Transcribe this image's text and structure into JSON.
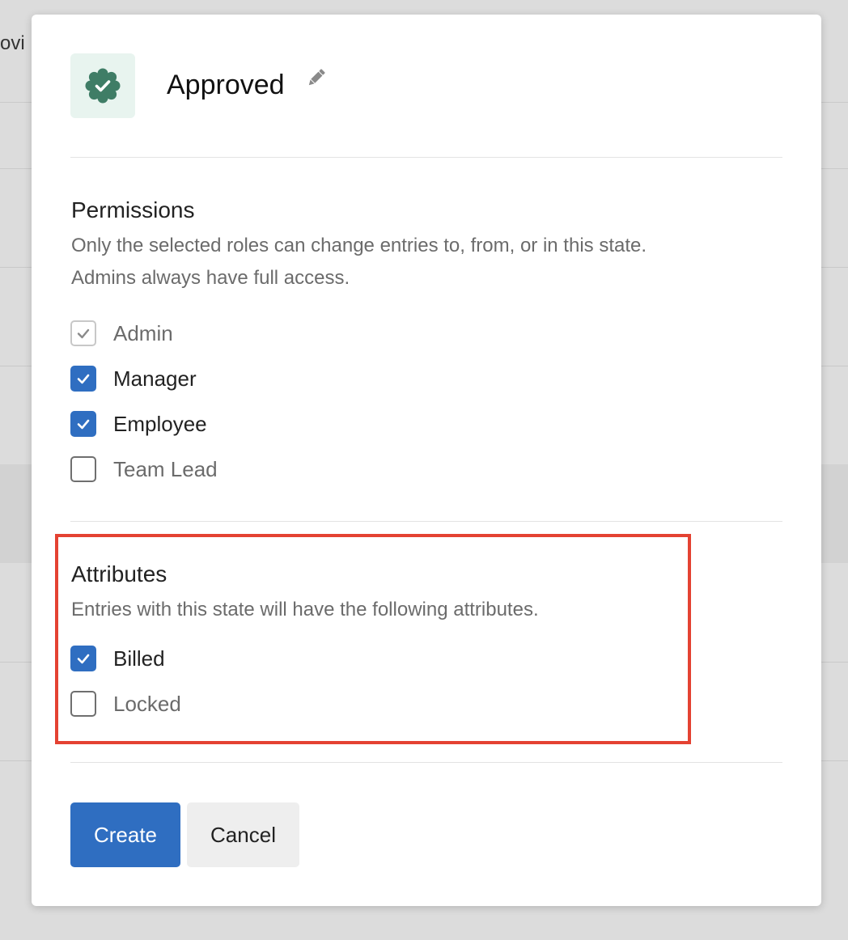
{
  "background": {
    "partial_text": "ovi"
  },
  "state": {
    "name": "Approved"
  },
  "permissions": {
    "title": "Permissions",
    "description_line1": "Only the selected roles can change entries to, from, or in this state.",
    "description_line2": "Admins always have full access.",
    "roles": [
      {
        "label": "Admin",
        "checked": true,
        "disabled": true
      },
      {
        "label": "Manager",
        "checked": true,
        "disabled": false
      },
      {
        "label": "Employee",
        "checked": true,
        "disabled": false
      },
      {
        "label": "Team Lead",
        "checked": false,
        "disabled": false
      }
    ]
  },
  "attributes": {
    "title": "Attributes",
    "description": "Entries with this state will have the following attributes.",
    "items": [
      {
        "label": "Billed",
        "checked": true
      },
      {
        "label": "Locked",
        "checked": false
      }
    ]
  },
  "buttons": {
    "create": "Create",
    "cancel": "Cancel"
  },
  "colors": {
    "primary": "#2f6ec1",
    "icon_green": "#3f7d66",
    "icon_bg": "#e8f4ef",
    "highlight_red": "#e44232"
  },
  "icons": {
    "state": "verified-badge-icon",
    "edit": "pencil-icon",
    "checked": "checkmark-icon"
  }
}
